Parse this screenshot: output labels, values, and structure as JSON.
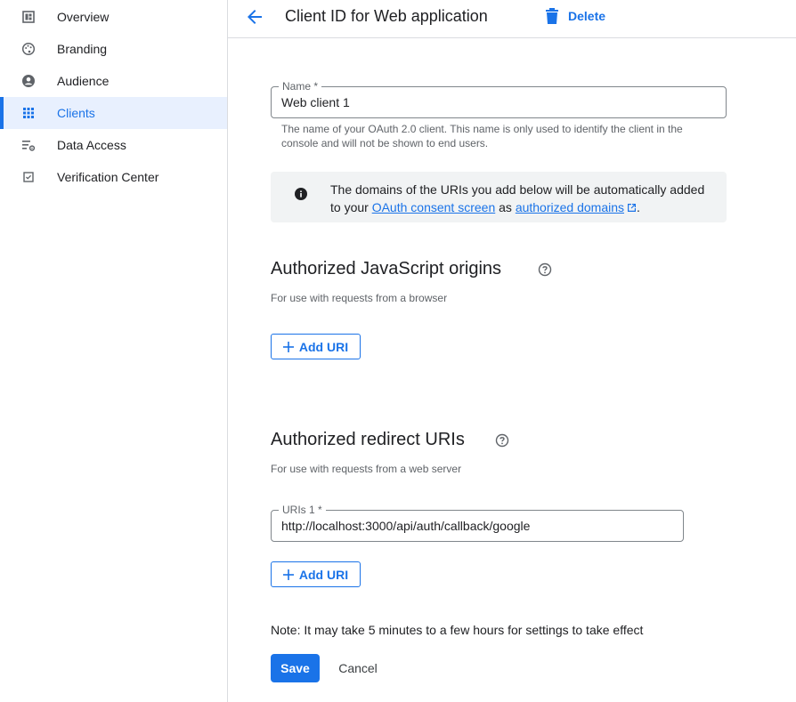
{
  "sidebar": {
    "items": [
      {
        "label": "Overview",
        "icon": "dashboard-icon"
      },
      {
        "label": "Branding",
        "icon": "palette-icon"
      },
      {
        "label": "Audience",
        "icon": "account-circle-icon"
      },
      {
        "label": "Clients",
        "icon": "apps-grid-icon",
        "active": true
      },
      {
        "label": "Data Access",
        "icon": "data-settings-icon"
      },
      {
        "label": "Verification Center",
        "icon": "check-box-icon"
      }
    ]
  },
  "header": {
    "title": "Client ID for Web application",
    "delete_label": "Delete"
  },
  "name_field": {
    "label": "Name *",
    "value": "Web client 1",
    "hint_line1": "The name of your OAuth 2.0 client. This name is only used to identify the client in the",
    "hint_line2": "console and will not be shown to end users."
  },
  "info": {
    "line1": "The domains of the URIs you add below will be automatically added",
    "prefix": "to your ",
    "link1": "OAuth consent screen",
    "middle": " as ",
    "link2": "authorized domains",
    "suffix": "."
  },
  "js_origins": {
    "title": "Authorized JavaScript origins",
    "subtitle": "For use with requests from a browser",
    "add_label": "Add URI"
  },
  "redirect_uris": {
    "title": "Authorized redirect URIs",
    "subtitle": "For use with requests from a web server",
    "uri_label": "URIs 1 *",
    "uri_value": "http://localhost:3000/api/auth/callback/google",
    "add_label": "Add URI"
  },
  "footer": {
    "note": "Note: It may take 5 minutes to a few hours for settings to take effect",
    "save_label": "Save",
    "cancel_label": "Cancel"
  },
  "colors": {
    "accent": "#1a73e8",
    "active_bg": "#e8f0fe",
    "info_bg": "#f1f3f4"
  }
}
